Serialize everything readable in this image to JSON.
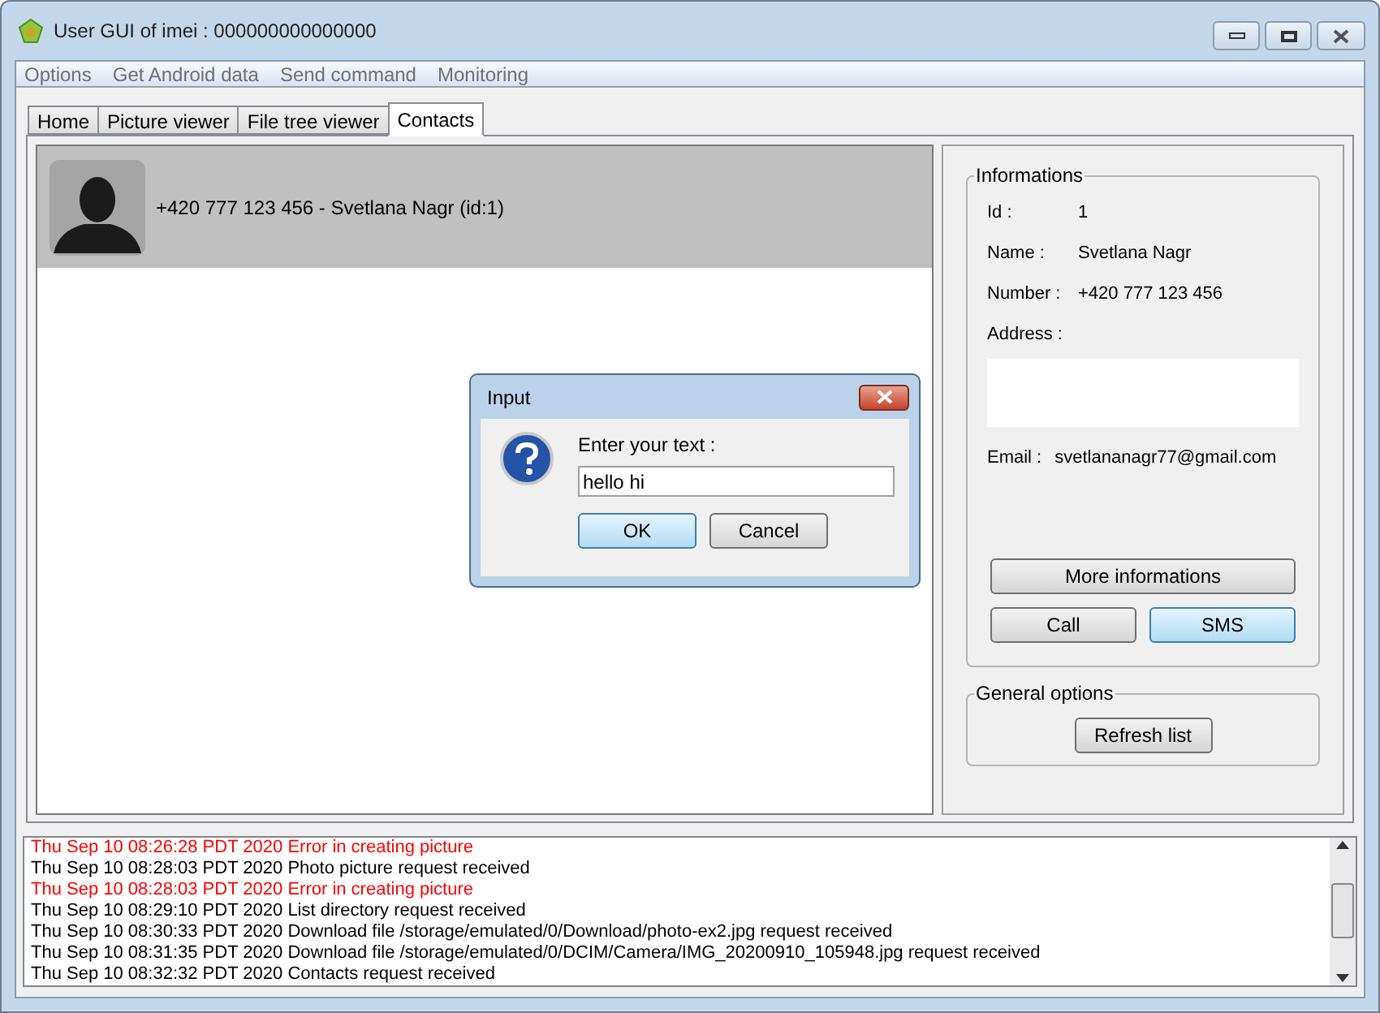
{
  "window": {
    "title": "User GUI of imei : 000000000000000"
  },
  "menu": [
    "Options",
    "Get Android data",
    "Send command",
    "Monitoring"
  ],
  "tabs": [
    {
      "label": "Home",
      "selected": false
    },
    {
      "label": "Picture viewer",
      "selected": false
    },
    {
      "label": "File tree viewer",
      "selected": false
    },
    {
      "label": "Contacts",
      "selected": true
    }
  ],
  "contacts": [
    {
      "label": "+420 777 123 456 - Svetlana Nagr (id:1)",
      "selected": true
    }
  ],
  "informations": {
    "title": "Informations",
    "fields": [
      {
        "label": "Id :",
        "value": "1"
      },
      {
        "label": "Name :",
        "value": "Svetlana Nagr"
      },
      {
        "label": "Number :",
        "value": "+420 777 123 456"
      }
    ],
    "address_label": "Address :",
    "email_label": "Email :",
    "email": "svetlananagr77@gmail.com",
    "buttons": [
      {
        "label": "More informations",
        "focused": false
      },
      {
        "label": "Call",
        "focused": false
      },
      {
        "label": "SMS",
        "focused": true
      }
    ]
  },
  "general_options": {
    "title": "General options",
    "button": "Refresh list"
  },
  "dialog": {
    "title": "Input",
    "prompt": "Enter your text :",
    "value": "hello hi",
    "buttons": [
      {
        "label": "OK",
        "focused": true
      },
      {
        "label": "Cancel",
        "focused": false
      }
    ]
  },
  "log": [
    {
      "kind": "error",
      "text": "Thu Sep 10 08:26:28 PDT 2020 Error in creating picture"
    },
    {
      "kind": "info",
      "text": "Thu Sep 10 08:28:03 PDT 2020 Photo picture request received"
    },
    {
      "kind": "error",
      "text": "Thu Sep 10 08:28:03 PDT 2020 Error in creating picture"
    },
    {
      "kind": "info",
      "text": "Thu Sep 10 08:29:10 PDT 2020 List directory request received"
    },
    {
      "kind": "info",
      "text": "Thu Sep 10 08:30:33 PDT 2020 Download file /storage/emulated/0/Download/photo-ex2.jpg request received"
    },
    {
      "kind": "info",
      "text": "Thu Sep 10 08:31:35 PDT 2020 Download file /storage/emulated/0/DCIM/Camera/IMG_20200910_105948.jpg request received"
    },
    {
      "kind": "info",
      "text": "Thu Sep 10 08:32:32 PDT 2020 Contacts request received"
    }
  ]
}
